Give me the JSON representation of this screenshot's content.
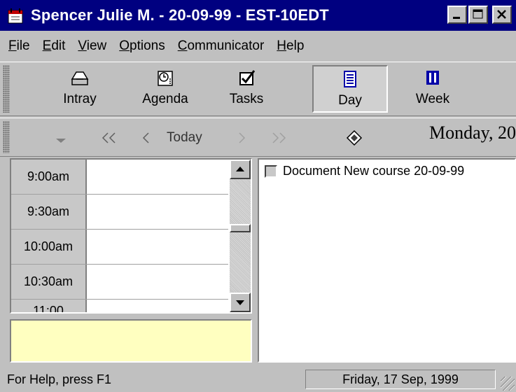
{
  "window": {
    "title": "Spencer Julie M. - 20-09-99 - EST-10EDT"
  },
  "menu": [
    {
      "label_u": "F",
      "label_rest": "ile"
    },
    {
      "label_u": "E",
      "label_rest": "dit"
    },
    {
      "label_u": "V",
      "label_rest": "iew"
    },
    {
      "label_u": "O",
      "label_rest": "ptions"
    },
    {
      "label_u": "C",
      "label_rest": "ommunicator"
    },
    {
      "label_u": "H",
      "label_rest": "elp"
    }
  ],
  "toolbar": {
    "intray": "Intray",
    "agenda": "Agenda",
    "tasks": "Tasks",
    "day": "Day",
    "week": "Week"
  },
  "nav": {
    "today": "Today",
    "date": "Monday, 20"
  },
  "schedule": {
    "times": [
      "9:00am",
      "9:30am",
      "10:00am",
      "10:30am",
      "11:00"
    ]
  },
  "tasks": {
    "items": [
      "Document New course 20-09-99"
    ]
  },
  "status": {
    "help": "For Help, press F1",
    "date": "Friday, 17 Sep, 1999"
  },
  "colors": {
    "titlebar": "#000080",
    "notes_background": "#ffffc0",
    "accent_blue": "#0000a8"
  }
}
